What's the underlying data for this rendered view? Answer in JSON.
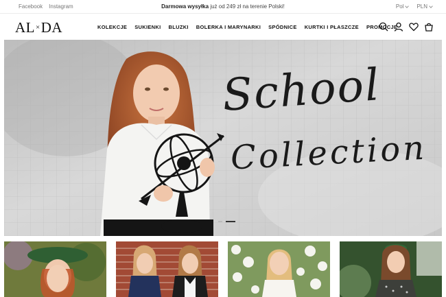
{
  "topbar": {
    "social": [
      "Facebook",
      "Instagram"
    ],
    "promo_bold": "Darmowa wysyłka",
    "promo_rest": " już od 249 zł na terenie Polski!",
    "language": "Pol",
    "currency": "PLN"
  },
  "header": {
    "logo_left": "AL",
    "logo_sep": "×",
    "logo_right": "DA",
    "nav": [
      "KOLEKCJE",
      "SUKIENKI",
      "BLUZKI",
      "BOLERKA I MARYNARKI",
      "SPÓDNICE",
      "KURTKI I PŁASZCZE",
      "PROMOCJE"
    ],
    "icons": [
      "search-icon",
      "account-icon",
      "heart-icon",
      "cart-icon"
    ]
  },
  "hero": {
    "title": "School",
    "subtitle": "Collection",
    "slides": 2,
    "active_slide": 2
  },
  "tiles": [
    {
      "name": "tile-green-hat"
    },
    {
      "name": "tile-brick-wall"
    },
    {
      "name": "tile-white-flowers"
    },
    {
      "name": "tile-green-leaves"
    }
  ],
  "colors": {
    "accent": "#1a1a1a",
    "hero_bg": "#cfcfcf"
  }
}
